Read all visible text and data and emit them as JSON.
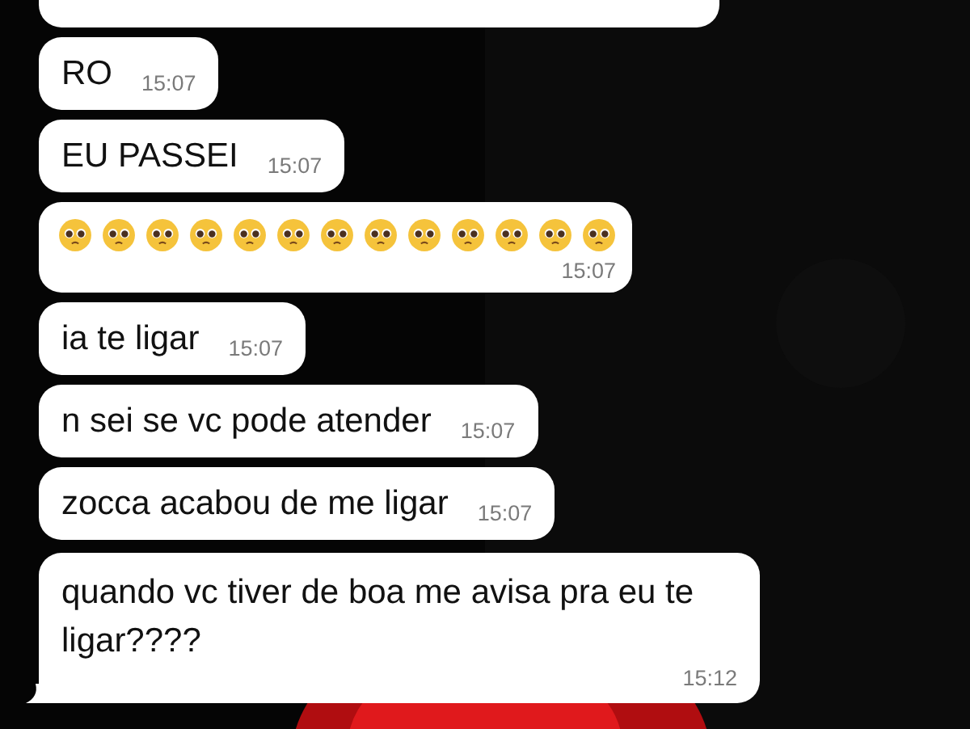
{
  "messages": [
    {
      "kind": "text",
      "text": "RO",
      "time": "15:07"
    },
    {
      "kind": "text",
      "text": "EU PASSEI",
      "time": "15:07"
    },
    {
      "kind": "emoji",
      "emojis": [
        {
          "kind": "pleading"
        },
        {
          "kind": "pleading"
        },
        {
          "kind": "pleading"
        },
        {
          "kind": "pleading"
        },
        {
          "kind": "pleading"
        },
        {
          "kind": "pleading"
        },
        {
          "kind": "pleading"
        },
        {
          "kind": "pleading"
        },
        {
          "kind": "pleading"
        },
        {
          "kind": "pleading"
        },
        {
          "kind": "pleading"
        },
        {
          "kind": "pleading"
        },
        {
          "kind": "pleading"
        }
      ],
      "time": "15:07"
    },
    {
      "kind": "text",
      "text": "ia te ligar",
      "time": "15:07"
    },
    {
      "kind": "text",
      "text": "n sei se vc pode atender",
      "time": "15:07"
    },
    {
      "kind": "text",
      "text": "zocca acabou de me ligar",
      "time": "15:07"
    },
    {
      "kind": "long",
      "text": "quando vc tiver de boa me avisa pra eu te ligar????",
      "time": "15:12"
    }
  ]
}
